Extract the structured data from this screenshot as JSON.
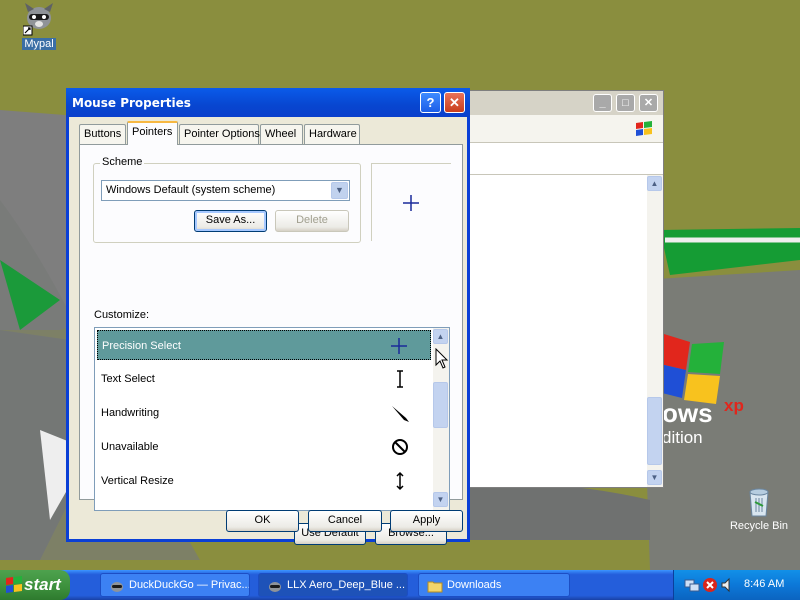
{
  "desktop": {
    "icons": [
      {
        "label": "Mypal"
      },
      {
        "label": "Recycle Bin"
      }
    ],
    "wallpaper_text": {
      "ows": "ows",
      "xp": "xp",
      "ition": "dition"
    }
  },
  "background_window": {
    "buttons": [
      "minimize",
      "maximize",
      "close"
    ]
  },
  "dialog": {
    "title": "Mouse Properties",
    "help_button": "?",
    "close_button": "✕",
    "tabs": [
      {
        "label": "Buttons"
      },
      {
        "label": "Pointers"
      },
      {
        "label": "Pointer Options"
      },
      {
        "label": "Wheel"
      },
      {
        "label": "Hardware"
      }
    ],
    "scheme": {
      "legend": "Scheme",
      "selected": "Windows Default (system scheme)",
      "save_as": "Save As...",
      "delete": "Delete"
    },
    "customize": {
      "label": "Customize:",
      "items": [
        {
          "label": "Precision Select",
          "icon": "crosshair-icon"
        },
        {
          "label": "Text Select",
          "icon": "ibeam-icon"
        },
        {
          "label": "Handwriting",
          "icon": "pen-icon"
        },
        {
          "label": "Unavailable",
          "icon": "unavailable-icon"
        },
        {
          "label": "Vertical Resize",
          "icon": "vertical-resize-icon"
        }
      ]
    },
    "use_default": "Use Default",
    "browse": "Browse...",
    "ok": "OK",
    "cancel": "Cancel",
    "apply": "Apply"
  },
  "taskbar": {
    "start": "start",
    "tasks": [
      {
        "label": "DuckDuckGo — Privac..."
      },
      {
        "label": "LLX Aero_Deep_Blue ..."
      },
      {
        "label": "Downloads"
      }
    ],
    "clock": "8:46 AM"
  },
  "colors": {
    "title_blue": "#0a5bea",
    "selection": "#5f9a9b",
    "taskbar": "#245edb",
    "start_green": "#3c8f3c"
  }
}
